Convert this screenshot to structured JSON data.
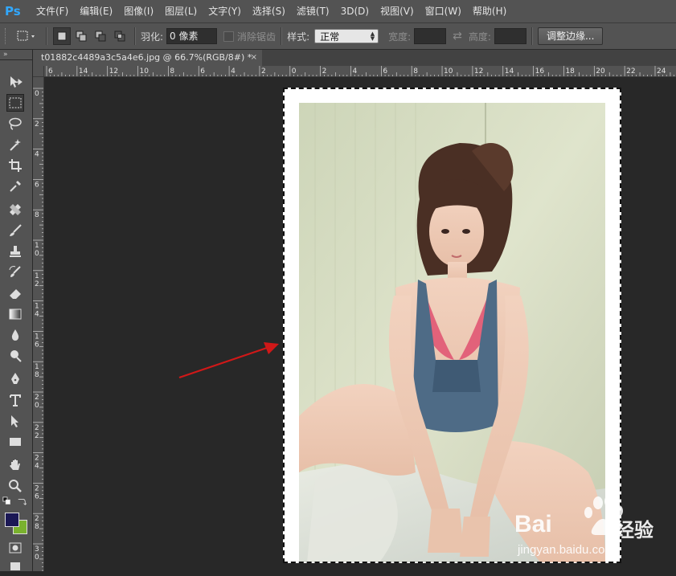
{
  "app": {
    "logo": "Ps"
  },
  "menu": [
    "文件(F)",
    "编辑(E)",
    "图像(I)",
    "图层(L)",
    "文字(Y)",
    "选择(S)",
    "滤镜(T)",
    "3D(D)",
    "视图(V)",
    "窗口(W)",
    "帮助(H)"
  ],
  "options": {
    "feather_label": "羽化:",
    "feather_value": "0 像素",
    "antialias_label": "消除锯齿",
    "style_label": "样式:",
    "style_value": "正常",
    "width_label": "宽度:",
    "height_label": "高度:",
    "refine_edge_label": "调整边缘..."
  },
  "panel_strip": "»",
  "document_tab": {
    "title": "t01882c4489a3c5a4e6.jpg @ 66.7%(RGB/8#) *",
    "close": "×"
  },
  "rulers": {
    "horizontal": [
      "6",
      "14",
      "12",
      "10",
      "8",
      "6",
      "4",
      "2",
      "0",
      "2",
      "4",
      "6",
      "8",
      "10",
      "12",
      "14",
      "16",
      "18",
      "20",
      "22",
      "24"
    ],
    "vertical": [
      "0",
      "2",
      "4",
      "6",
      "8",
      "1\n0",
      "1\n2",
      "1\n4",
      "1\n6",
      "1\n8",
      "2\n0",
      "2\n2",
      "2\n4",
      "2\n6",
      "2\n8",
      "3\n0"
    ]
  },
  "watermark": {
    "brand_main": "Bai",
    "brand_cn": "经验",
    "url": "jingyan.baidu.com"
  },
  "colors": {
    "foreground": "#1b1855",
    "background": "#7ab22e",
    "accent_arrow": "#d01818",
    "logo": "#31a8ff"
  }
}
